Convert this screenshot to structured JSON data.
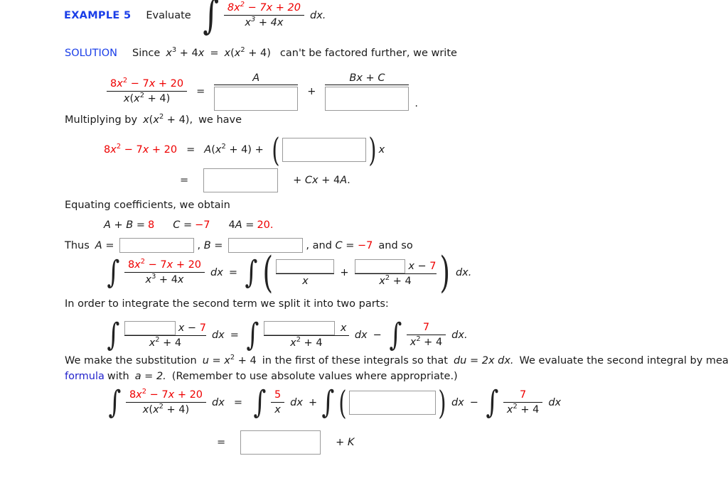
{
  "example": {
    "label": "EXAMPLE 5",
    "verb": "Evaluate",
    "integrand_num": "8x2 − 7x + 20",
    "integrand_den": "x3 + 4x",
    "dx": "dx."
  },
  "solution": {
    "label": "SOLUTION",
    "text_before": "Since",
    "identity_left": "x3 + 4x",
    "equals": "=",
    "identity_right": "x(x2 + 4)",
    "text_after": "can't be factored further, we write"
  },
  "eq1": {
    "lhs_num": "8x2 − 7x + 20",
    "lhs_den": "x(x2 + 4)",
    "equals": "=",
    "term1_num": "A",
    "plus": "+",
    "term2_num": "Bx + C",
    "period": "."
  },
  "multiply": {
    "text": "Multiplying by",
    "expr": "x(x2 + 4),",
    "text2": "we have"
  },
  "eq2": {
    "lhs": "8x2 − 7x + 20",
    "equals": "=",
    "rhs_a": "A(x2 + 4) +",
    "trailing_x": "x",
    "line2_equals": "=",
    "line2_tail": "+ Cx + 4A."
  },
  "equating": {
    "text": "Equating coefficients, we obtain",
    "c1_lhs": "A + B =",
    "c1_rhs": "8",
    "c2_lhs": "C =",
    "c2_rhs": "−7",
    "c3_lhs": "4A =",
    "c3_rhs": "20.",
    "thus": "Thus",
    "a_label": "A =",
    "b_sep": ", B =",
    "c_tail_1": ", and C =",
    "c_tail_val": "−7",
    "c_tail_2": "and so"
  },
  "eq3": {
    "lhs_num": "8x2 − 7x + 20",
    "lhs_den": "x3 + 4x",
    "dx": "dx",
    "equals": "=",
    "t1_den": "x",
    "plus": "+",
    "t2_num_tail": "x − 7",
    "t2_den": "x2 + 4",
    "dx_end": "dx."
  },
  "split": {
    "text": "In order to integrate the second term we split it into two parts:"
  },
  "eq4": {
    "t1_num_tail": "x − 7",
    "t1_den": "x2 + 4",
    "dx1": "dx",
    "equals": "=",
    "t2_num_tail": "x",
    "t2_den": "x2 + 4",
    "dx2": "dx",
    "minus": "−",
    "t3_num": "7",
    "t3_den": "x2 + 4",
    "dx3": "dx."
  },
  "substitution": {
    "p1": "We make the substitution",
    "u_expr": "u = x2 + 4",
    "p2": "in the first of these integrals so that",
    "du_expr": "du = 2x dx.",
    "p3": "We evaluate the second integral by means of",
    "link": "this formula",
    "p4": "with",
    "a_expr": "a = 2.",
    "p5": "(Remember to use absolute values where appropriate.)"
  },
  "eq5": {
    "lhs_num": "8x2 − 7x + 20",
    "lhs_den": "x(x2 + 4)",
    "dx": "dx",
    "equals": "=",
    "t1_num": "5",
    "t1_den": "x",
    "dx1": "dx",
    "plus": "+",
    "dx2": "dx",
    "minus": "−",
    "t3_num": "7",
    "t3_den": "x2 + 4",
    "dx3": "dx",
    "final_equals": "=",
    "final_tail": "+ K"
  },
  "colors": {
    "red": "#ee0000",
    "blue": "#1a3ee8",
    "link": "#2222cc",
    "box_border": "#9a9a9a"
  }
}
